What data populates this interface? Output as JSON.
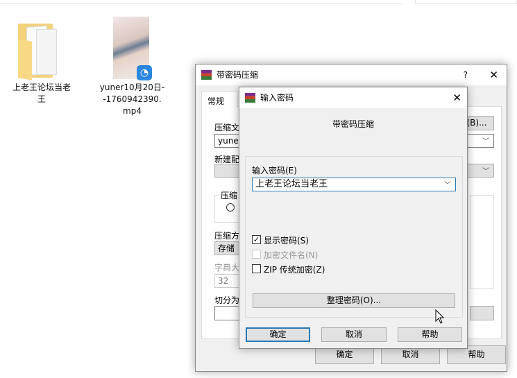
{
  "desktop": {
    "items": [
      {
        "label": "上老王论坛当老王",
        "type": "folder"
      },
      {
        "label": "yuner10月20日--1760942390.mp4",
        "type": "video"
      }
    ]
  },
  "main_dialog": {
    "title": "带密码压缩",
    "help": "?",
    "close": "✕",
    "tab": "常规",
    "labels": {
      "archive_name": "压缩文",
      "profile": "新建配",
      "group": "压缩",
      "method": "压缩方",
      "dict": "字典大",
      "split": "切分为"
    },
    "archive_value": "yuner1",
    "browse": "(B)...",
    "method_value": "存储",
    "dict_value": "32",
    "ok": "确定",
    "cancel": "取消",
    "help_btn": "帮助"
  },
  "password_dialog": {
    "title": "输入密码",
    "close": "✕",
    "heading": "带密码压缩",
    "enter_label": "输入密码(E)",
    "password_value": "上老王论坛当老王",
    "show_password": {
      "label": "显示密码(S)",
      "checked": true
    },
    "encrypt_names": {
      "label": "加密文件名(N)",
      "checked": false,
      "disabled": true
    },
    "zip_legacy": {
      "label": "ZIP 传统加密(Z)",
      "checked": false
    },
    "organize": "整理密码(O)...",
    "ok": "确定",
    "cancel": "取消",
    "help": "帮助"
  }
}
